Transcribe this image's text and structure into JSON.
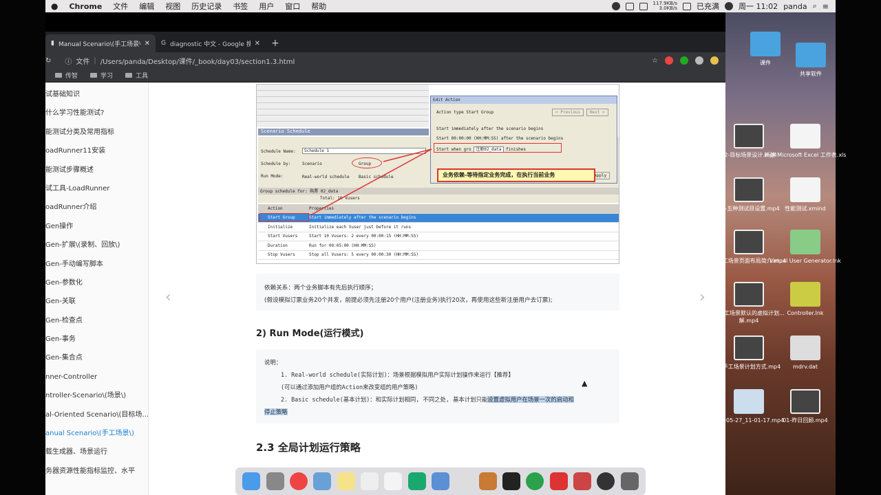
{
  "menubar": {
    "app": "Chrome",
    "menus": [
      "文件",
      "编辑",
      "视图",
      "历史记录",
      "书签",
      "用户",
      "窗口",
      "帮助"
    ],
    "net_up": "117.9KB/s",
    "net_down": "3.0KB/s",
    "battery": "已充满",
    "clock": "周一 11:02",
    "user": "panda"
  },
  "tabs": [
    {
      "title": "Manual Scenario\\(手工场景\\) | …"
    },
    {
      "title": "diagnostic 中文 - Google 搜索"
    }
  ],
  "toolbar": {
    "scheme": "文件",
    "url": "/Users/panda/Desktop/课件/_book/day03/section1.3.html"
  },
  "bookmarks": [
    "传智",
    "学习",
    "工具"
  ],
  "sidebar": [
    "试基础知识",
    "什么学习性能测试?",
    "能测试分类及常用指标",
    "oadRunner11安装",
    "能测试步骤概述",
    "试工具-LoadRunner",
    "oadRunner介绍",
    "Gen操作",
    "Gen-扩展\\(录制、回放\\)",
    "Gen-手动编写脚本",
    "Gen-参数化",
    "Gen-关联",
    "Gen-检查点",
    "Gen-事务",
    "Gen-集合点",
    "nner-Controller",
    "ntroller-Scenario\\(场景\\)",
    "al-Oriented Scenario\\(目标场…",
    "anual Scenario\\(手工场景\\)",
    "载生成器、场景运行",
    "务器资源性能指标监控、水平"
  ],
  "screenshot": {
    "schedule_title": "Scenario Schedule",
    "schedule_name_label": "Schedule Name:",
    "schedule_name": "Schedule 1",
    "schedule_by_label": "Schedule by:",
    "opt_scenario": "Scenario",
    "opt_group": "Group",
    "run_mode_label": "Run Mode:",
    "opt_real": "Real-world schedule",
    "opt_basic": "Basic schedule",
    "group_schedule": "Group schedule for: 购票 02_data",
    "total": "Total: 10 Vusers",
    "col_action": "Action",
    "col_props": "Properties",
    "rows": [
      {
        "a": "Start Group",
        "p": "Start immediately after the scenario begins"
      },
      {
        "a": "Initialize",
        "p": "Initialize each Vuser just before it runs"
      },
      {
        "a": "Start  Vusers",
        "p": "Start 10 Vusers: 2 every 00:00:15  (HH:MM:SS)"
      },
      {
        "a": "Duration",
        "p": "Run for 00:05:00  (HH:MM:SS)"
      },
      {
        "a": "Stop Vusers",
        "p": "Stop all Vusers: 5 every 00:00:30  (HH:MM:SS)"
      }
    ],
    "dialog_title": "Edit Action",
    "action_type": "Action type Start Group",
    "btn_prev": "< Previous",
    "btn_next": "Next >",
    "opt1": "Start immediately after the scenario begins",
    "opt2": "Start  00:00:00  (HH:MM:SS)  after the scenario begins",
    "opt3_a": "Start when gro",
    "opt3_b": "注册02_data",
    "opt3_c": "finishes",
    "apply": "Apply",
    "callout": "业务依赖-等待指定业务完成，在执行当前业务"
  },
  "content": {
    "note1_line1": "依赖关系：两个业务脚本有先后执行顺序；",
    "note1_line2": "(假设模拟订票业务20个并发，前提必须先注册20个用户(注册业务)执行20次，再使用这些新注册用户去订票);",
    "h2": "2) Run Mode(运行模式)",
    "n2_l1": "说明：",
    "n2_l2": "1. Real-world schedule(实际计划)：场景根据模拟用户实际计划操作来运行【推荐】",
    "n2_l3": "(可以通过添加用户组的Action来改变组的用户策略)",
    "n2_l4a": "2. Basic schedule(基本计划)：和实际计划相同, 不同之处, 基本计划只能",
    "n2_l4b": "设置虚拟用户在场景一次的启动和",
    "n2_l5": "停止策略",
    "h3": "2.3 全局计划运行策略"
  },
  "desktop": [
    {
      "label": "课件"
    },
    {
      "label": "共享软件"
    },
    {
      "label": "02-目标场景设计.mp4"
    },
    {
      "label": "新建 Microsoft Excel 工作表.xls"
    },
    {
      "label": "03-五种测试目设置.mp4"
    },
    {
      "label": "性能测试.xmind"
    },
    {
      "label": "4-手工场景页面布局简介.mp4"
    },
    {
      "label": "Virtual User Generator.lnk"
    },
    {
      "label": "5-手工场景默认的虚拟计划…解.mp4"
    },
    {
      "label": "Controller.lnk"
    },
    {
      "label": "6-手工场景计划方式.mp4"
    },
    {
      "label": "mdrv.dat"
    },
    {
      "label": "019-05-27_11-01-17.mp4"
    },
    {
      "label": "01-昨日回顾.mp4"
    }
  ]
}
